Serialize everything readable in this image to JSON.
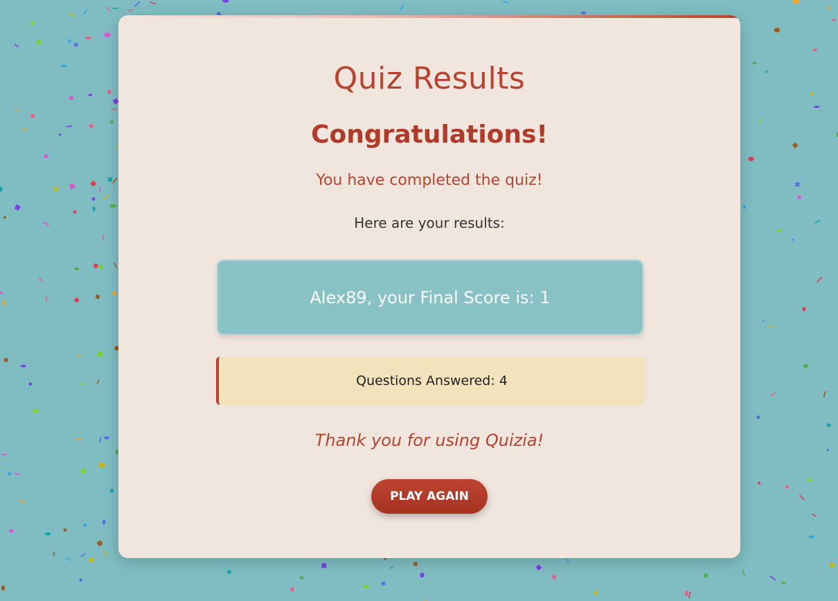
{
  "page": {
    "title": "Quiz Results",
    "congrats": "Congratulations!",
    "completed": "You have completed the quiz!",
    "results_intro": "Here are your results:",
    "score_text": "Alex89, your Final Score is: 1",
    "answered_text": "Questions Answered: 4",
    "thanks": "Thank you for using Quizia!",
    "play_again_label": "PLAY AGAIN"
  },
  "colors": {
    "background": "#7fbdc2",
    "card": "#f0e6de",
    "accent": "#b8432f",
    "score_box": "#88c2c5",
    "answered_box": "#f3e3bd",
    "confetti": [
      "#e23b5a",
      "#7b3fe4",
      "#2fa7e8",
      "#f5a623",
      "#4caf50",
      "#e24fd6",
      "#c9b400",
      "#9c5a1e",
      "#1aa3b0",
      "#f05a7e",
      "#5a6ee8",
      "#7ed321"
    ]
  }
}
